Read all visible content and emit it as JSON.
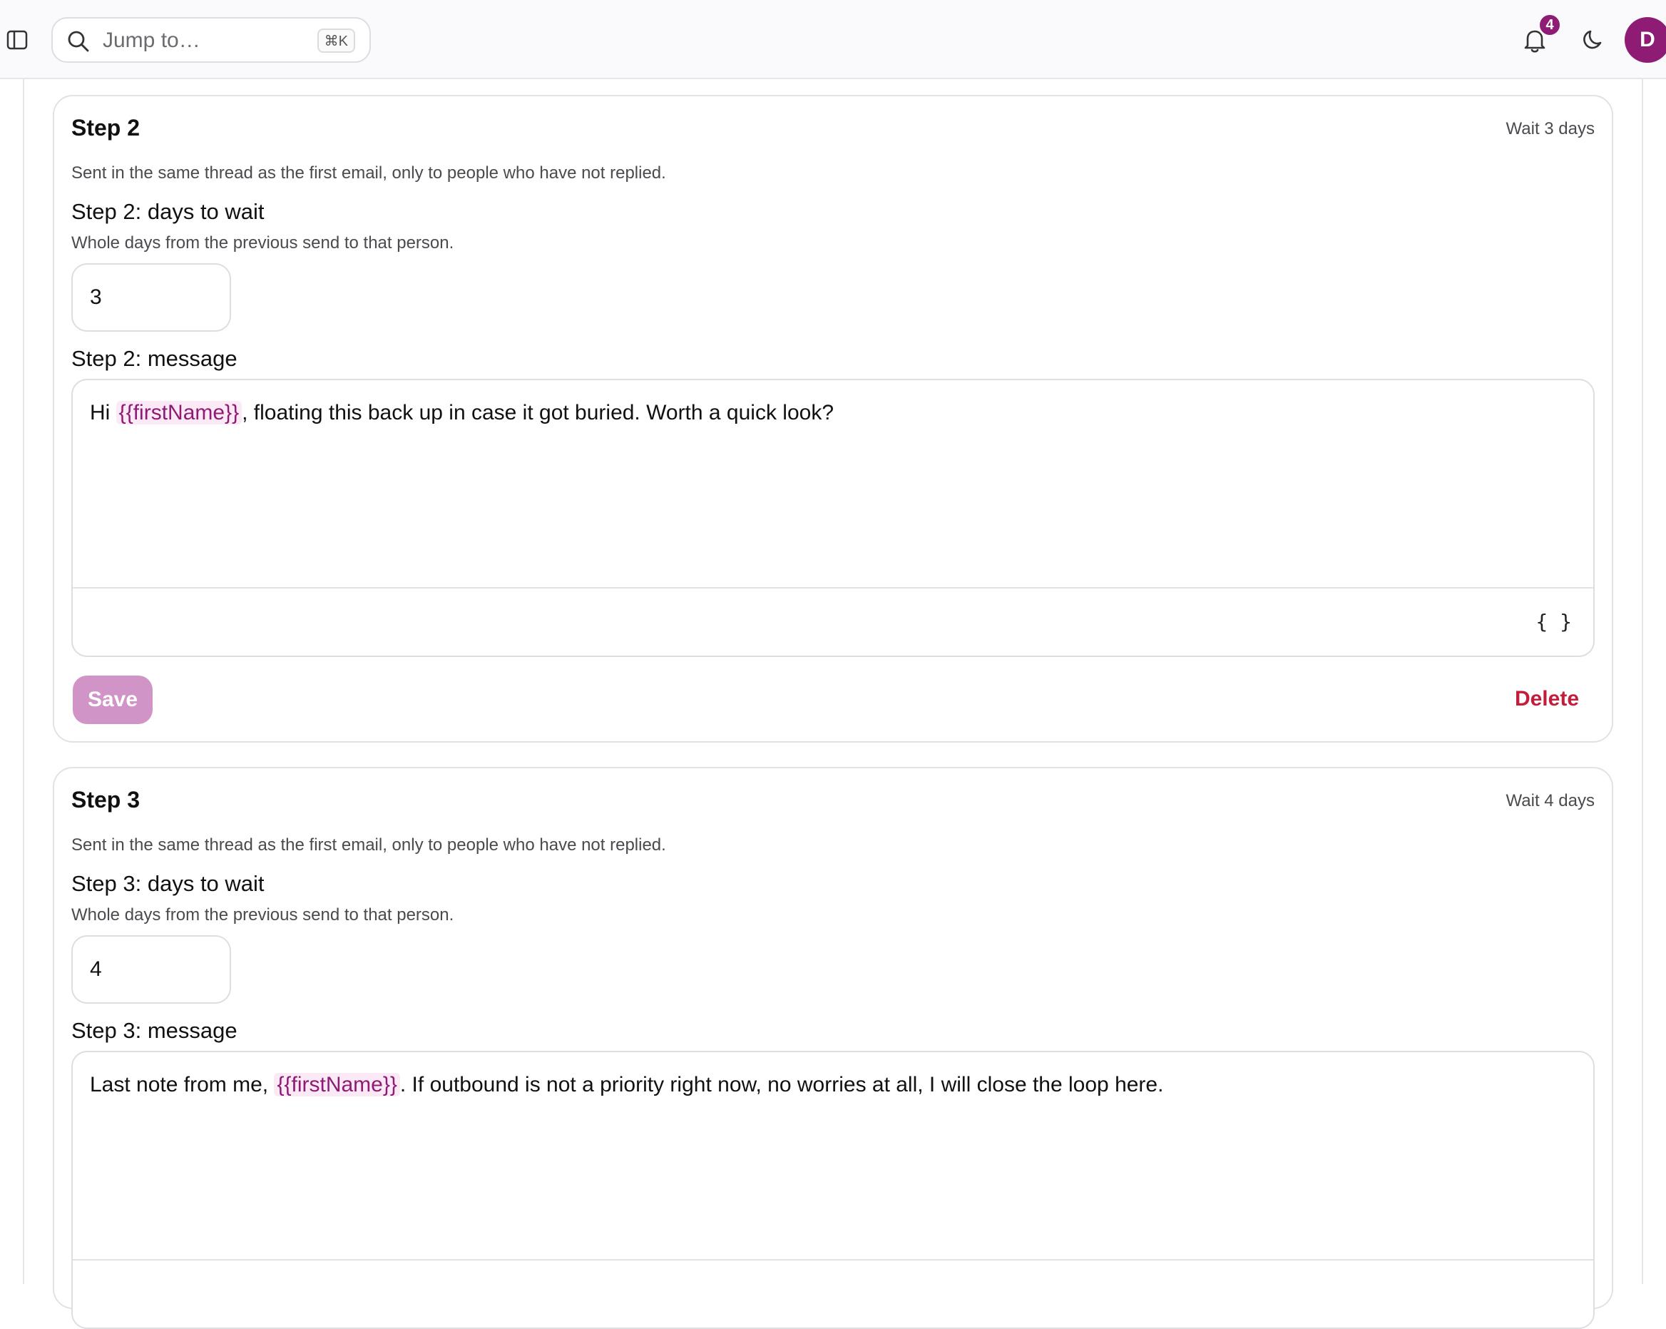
{
  "topbar": {
    "search": {
      "placeholder": "Jump to…",
      "shortcut": "⌘K"
    },
    "notifications": {
      "count": "4"
    },
    "avatar": {
      "initial": "D"
    }
  },
  "steps": [
    {
      "title": "Step 2",
      "wait_summary": "Wait 3 days",
      "description": "Sent in the same thread as the first email, only to people who have not replied.",
      "days_label": "Step 2: days to wait",
      "days_help": "Whole days from the previous send to that person.",
      "days_value": "3",
      "message_label": "Step 2: message",
      "message": {
        "before": "Hi ",
        "variable": "{{firstName}}",
        "after": ", floating this back up in case it got buried. Worth a quick look?"
      },
      "variable_button": "{ }",
      "save_label": "Save",
      "delete_label": "Delete"
    },
    {
      "title": "Step 3",
      "wait_summary": "Wait 4 days",
      "description": "Sent in the same thread as the first email, only to people who have not replied.",
      "days_label": "Step 3: days to wait",
      "days_help": "Whole days from the previous send to that person.",
      "days_value": "4",
      "message_label": "Step 3: message",
      "message": {
        "before": "Last note from me, ",
        "variable": "{{firstName}}",
        "after": ". If outbound is not a priority right now, no worries at all, I will close the loop here."
      }
    }
  ],
  "colors": {
    "accent": "#8e1b74",
    "save_disabled": "#d194c6",
    "danger": "#c41d3b",
    "variable_bg": "#fbeaf6"
  }
}
